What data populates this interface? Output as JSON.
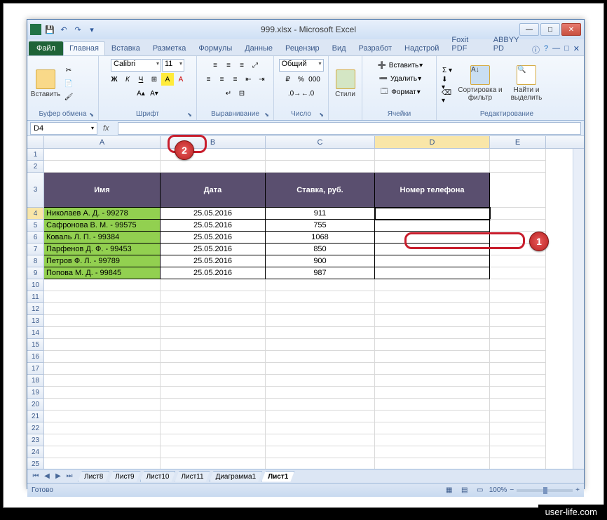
{
  "title": "999.xlsx - Microsoft Excel",
  "tabs": {
    "file": "Файл",
    "home": "Главная",
    "insert": "Вставка",
    "layout": "Разметка",
    "formulas": "Формулы",
    "data": "Данные",
    "review": "Рецензир",
    "view": "Вид",
    "dev": "Разработ",
    "addins": "Надстрой",
    "foxit": "Foxit PDF",
    "abbyy": "ABBYY PD"
  },
  "ribbon": {
    "clipboard": {
      "paste": "Вставить",
      "label": "Буфер обмена"
    },
    "font": {
      "name": "Calibri",
      "size": "11",
      "label": "Шрифт"
    },
    "align": {
      "label": "Выравнивание"
    },
    "number": {
      "format": "Общий",
      "label": "Число"
    },
    "styles": {
      "btn": "Стили",
      "label": ""
    },
    "cells": {
      "insert": "Вставить",
      "delete": "Удалить",
      "format": "Формат",
      "label": "Ячейки"
    },
    "editing": {
      "sort": "Сортировка и фильтр",
      "find": "Найти и выделить",
      "label": "Редактирование"
    }
  },
  "namebox": "D4",
  "columns": [
    "A",
    "B",
    "C",
    "D",
    "E"
  ],
  "headers": {
    "A": "Имя",
    "B": "Дата",
    "C": "Ставка, руб.",
    "D": "Номер телефона"
  },
  "rows": [
    {
      "A": "Николаев А. Д. - 99278",
      "B": "25.05.2016",
      "C": "911",
      "D": ""
    },
    {
      "A": "Сафронова В. М. - 99575",
      "B": "25.05.2016",
      "C": "755",
      "D": ""
    },
    {
      "A": "Коваль Л. П. - 99384",
      "B": "25.05.2016",
      "C": "1068",
      "D": ""
    },
    {
      "A": "Парфенов Д. Ф. - 99453",
      "B": "25.05.2016",
      "C": "850",
      "D": ""
    },
    {
      "A": "Петров Ф. Л. - 99789",
      "B": "25.05.2016",
      "C": "900",
      "D": ""
    },
    {
      "A": "Попова М. Д. - 99845",
      "B": "25.05.2016",
      "C": "987",
      "D": ""
    }
  ],
  "sheets": [
    "Лист8",
    "Лист9",
    "Лист10",
    "Лист11",
    "Диаграмма1",
    "Лист1"
  ],
  "active_sheet": "Лист1",
  "status": "Готово",
  "zoom": "100%",
  "callouts": {
    "c1": "1",
    "c2": "2"
  },
  "watermark": "user-life.com"
}
